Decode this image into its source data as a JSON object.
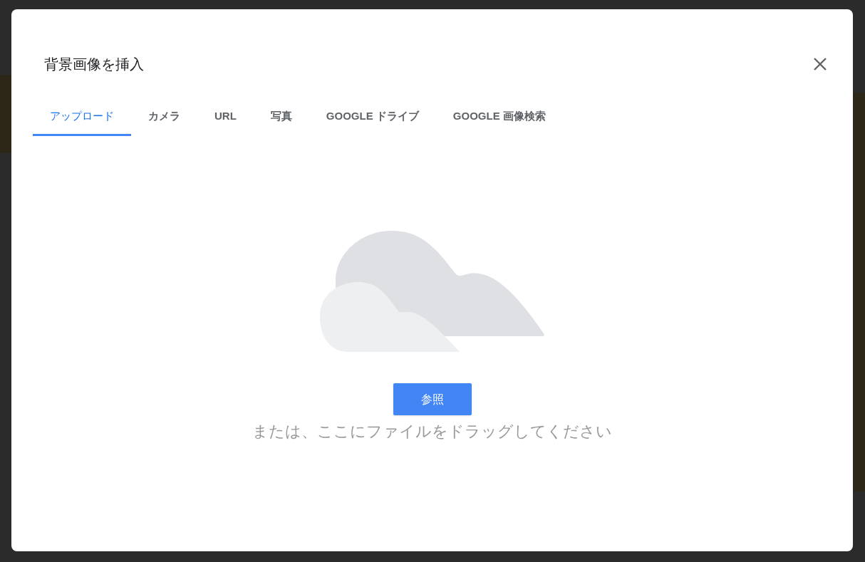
{
  "dialog": {
    "title": "背景画像を挿入",
    "tabs": [
      {
        "label": "アップロード",
        "selected": true
      },
      {
        "label": "カメラ",
        "selected": false
      },
      {
        "label": "URL",
        "selected": false
      },
      {
        "label": "写真",
        "selected": false
      },
      {
        "label": "GOOGLE ドライブ",
        "selected": false
      },
      {
        "label": "GOOGLE 画像検索",
        "selected": false
      }
    ],
    "browse_button": "参照",
    "hint": "または、ここにファイルをドラッグしてください"
  }
}
